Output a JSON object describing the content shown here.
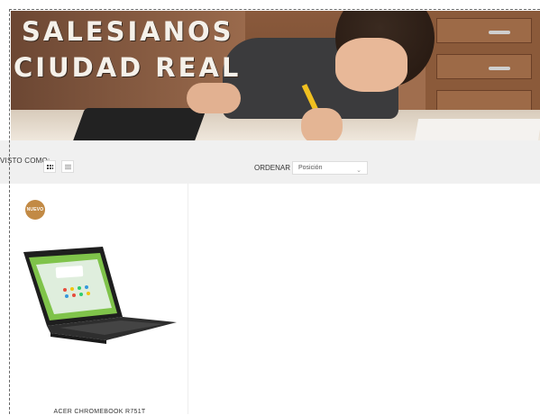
{
  "banner": {
    "logo_line1": "SALESIANOS",
    "logo_line2": "CIUDAD REAL"
  },
  "toolbar": {
    "view_label": "VISTO COMO:",
    "view_modes": [
      "grid-icon",
      "list-icon"
    ],
    "sort_label": "ORDENAR POR:",
    "sort_value": "Posición"
  },
  "products": [
    {
      "badge": "NUEVO",
      "name": "ACER CHROMEBOOK R751T"
    }
  ],
  "colors": {
    "badge": "#c28a45",
    "toolbar_bg": "#f0f0f0"
  }
}
